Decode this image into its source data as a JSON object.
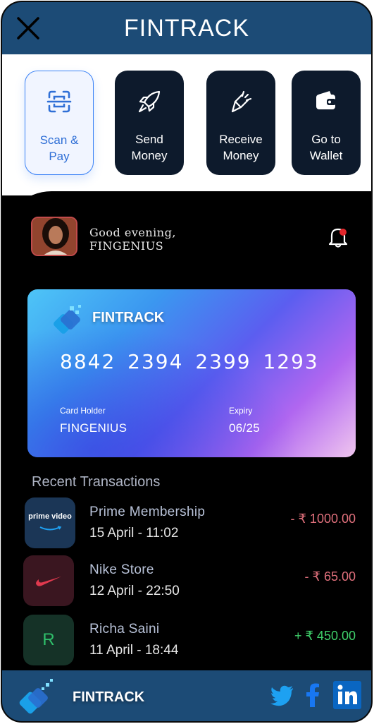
{
  "app": {
    "title": "FINTRACK"
  },
  "actions": [
    {
      "label": "Scan &\nPay",
      "icon": "scan-icon"
    },
    {
      "label": "Send\nMoney",
      "icon": "rocket-icon"
    },
    {
      "label": "Receive\nMoney",
      "icon": "receive-icon"
    },
    {
      "label": "Go to\nWallet",
      "icon": "wallet-icon"
    }
  ],
  "user": {
    "greeting": "Good evening,",
    "name": "FINGENIUS"
  },
  "card": {
    "brand": "FINTRACK",
    "number": "8842  2394  2399 1293",
    "holder_label": "Card Holder",
    "holder": "FINGENIUS",
    "expiry_label": "Expiry",
    "expiry": "06/25"
  },
  "transactions_title": "Recent Transactions",
  "transactions": [
    {
      "name": "Prime Membership",
      "date": "15 April  - 11:02",
      "amount": "- ₹ 1000.00",
      "type": "debit",
      "logo_text": "prime video"
    },
    {
      "name": "Nike Store",
      "date": "12 April  - 22:50",
      "amount": "- ₹ 65.00",
      "type": "debit"
    },
    {
      "name": "Richa Saini",
      "date": "11 April  - 18:44",
      "amount": "+ ₹ 450.00",
      "type": "credit",
      "initial": "R"
    }
  ],
  "footer": {
    "brand": "FINTRACK"
  },
  "colors": {
    "header": "#1c4b76",
    "debit": "#e0707c",
    "credit": "#3fcf6a",
    "accent": "#3b82f6"
  }
}
